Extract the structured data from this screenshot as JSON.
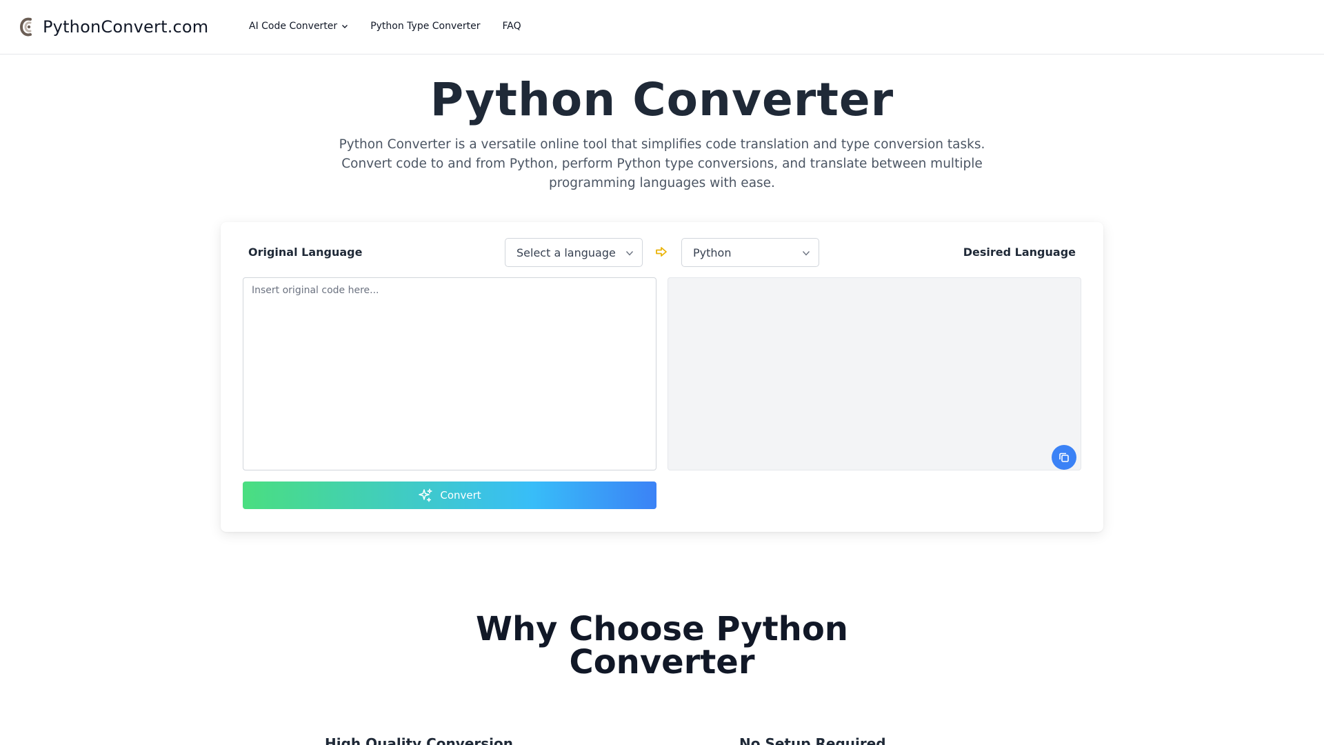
{
  "header": {
    "brand": "PythonConvert.com",
    "nav": [
      {
        "label": "AI Code Converter",
        "has_dropdown": true
      },
      {
        "label": "Python Type Converter"
      },
      {
        "label": "FAQ"
      }
    ]
  },
  "hero": {
    "title": "Python Converter",
    "description": "Python Converter is a versatile online tool that simplifies code translation and type conversion tasks. Convert code to and from Python, perform Python type conversions, and translate between multiple programming languages with ease."
  },
  "converter": {
    "original_label": "Original Language",
    "desired_label": "Desired Language",
    "source_select": {
      "value": "Select a language"
    },
    "target_select": {
      "value": "Python"
    },
    "input": {
      "placeholder": "Insert original code here...",
      "value": ""
    },
    "output": {
      "value": ""
    },
    "convert_label": "Convert",
    "colors": {
      "accent": "#3b82f6",
      "gradient_start": "#4ade80",
      "gradient_end": "#3b82f6",
      "arrow": "#eab308"
    }
  },
  "why": {
    "title_line1": "Why Choose Python",
    "title_line2": "Converter",
    "features": [
      {
        "title": "High Quality Conversion"
      },
      {
        "title": "No Setup Required"
      }
    ]
  }
}
